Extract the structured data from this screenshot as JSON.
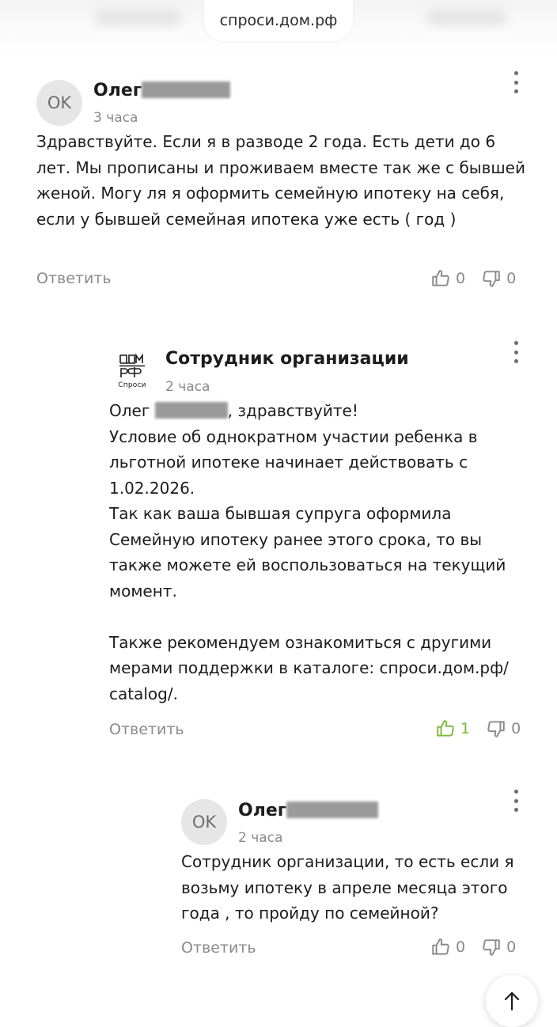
{
  "browser": {
    "url": "спроси.дом.рф"
  },
  "comments": [
    {
      "avatar_initials": "OK",
      "author": "Олег",
      "time": "3 часа",
      "text": "Здравствуйте. Если я в разводе 2 года. Есть дети до 6 лет. Мы прописаны и проживаем вместе так же с бывшей женой. Могу ля я оформить семейную ипотеку на себя, если у бывшей семейная ипотека уже есть ( год )",
      "reply_label": "Ответить",
      "likes": "0",
      "dislikes": "0"
    },
    {
      "avatar_label": "Спроси",
      "author": "Сотрудник организации",
      "time": "2 часа",
      "greeting_name": "Олег",
      "greeting_suffix": ", здравствуйте!",
      "para1": "Условие об однократном участии ребенка в льготной ипотеке начинает действовать с 1.02.2026.",
      "para2": "Так как ваша бывшая супруга оформила Семейную ипотеку ранее этого срока, то вы также можете ей воспользоваться на текущий момент.",
      "para3": "Также рекомендуем ознакомиться с другими мерами поддержки в каталоге: спроси.дом.рф/ catalog/.",
      "reply_label": "Ответить",
      "likes": "1",
      "dislikes": "0"
    },
    {
      "avatar_initials": "OK",
      "author": "Олег",
      "time": "2 часа",
      "text": "Сотрудник организации, то есть если я возьму ипотеку в апреле месяца этого года , то пройду по семейной?",
      "reply_label": "Ответить",
      "likes": "0",
      "dislikes": "0"
    }
  ],
  "colors": {
    "liked": "#7bb83a",
    "muted": "#8a8a8a",
    "text": "#1c1c1c"
  }
}
